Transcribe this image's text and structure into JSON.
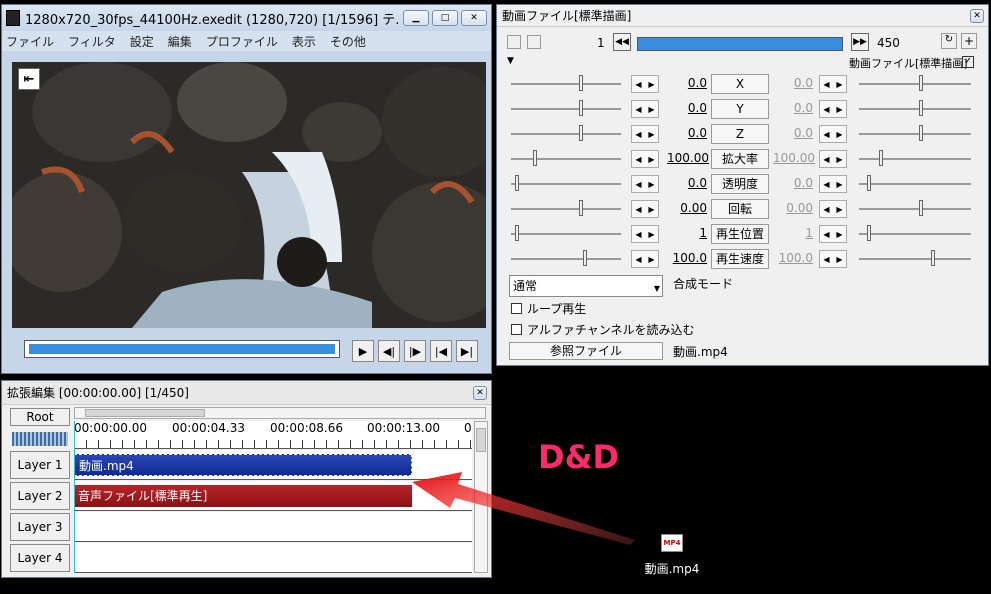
{
  "main_window": {
    "title": "1280x720_30fps_44100Hz.exedit (1280,720)  [1/1596]  テ...",
    "menu": [
      "ファイル",
      "フィルタ",
      "設定",
      "編集",
      "プロファイル",
      "表示",
      "その他"
    ]
  },
  "property_window": {
    "title": "動画ファイル[標準描画]",
    "frame_start": "1",
    "frame_end": "450",
    "section_label": "動画ファイル[標準描画]",
    "params": [
      {
        "label": "X",
        "value": "0.0",
        "end": "0.0"
      },
      {
        "label": "Y",
        "value": "0.0",
        "end": "0.0"
      },
      {
        "label": "Z",
        "value": "0.0",
        "end": "0.0"
      },
      {
        "label": "拡大率",
        "value": "100.00",
        "end": "100.00"
      },
      {
        "label": "透明度",
        "value": "0.0",
        "end": "0.0"
      },
      {
        "label": "回転",
        "value": "0.00",
        "end": "0.00"
      },
      {
        "label": "再生位置",
        "value": "1",
        "end": "1"
      },
      {
        "label": "再生速度",
        "value": "100.0",
        "end": "100.0"
      }
    ],
    "blend_mode_value": "通常",
    "blend_mode_label": "合成モード",
    "loop_label": "ループ再生",
    "alpha_label": "アルファチャンネルを読み込む",
    "ref_file_button": "参照ファイル",
    "ref_file_name": "動画.mp4"
  },
  "timeline": {
    "title": "拡張編集 [00:00:00.00] [1/450]",
    "root": "Root",
    "times": [
      "00:00:00.00",
      "00:00:04.33",
      "00:00:08.66",
      "00:00:13.00",
      "0"
    ],
    "layers": [
      "Layer 1",
      "Layer 2",
      "Layer 3",
      "Layer 4"
    ],
    "clip1": "動画.mp4",
    "clip2": "音声ファイル[標準再生]"
  },
  "overlay": {
    "dd_text": "D&D"
  },
  "desktop_file": {
    "name": "動画.mp4",
    "icon_text": "MP4"
  }
}
